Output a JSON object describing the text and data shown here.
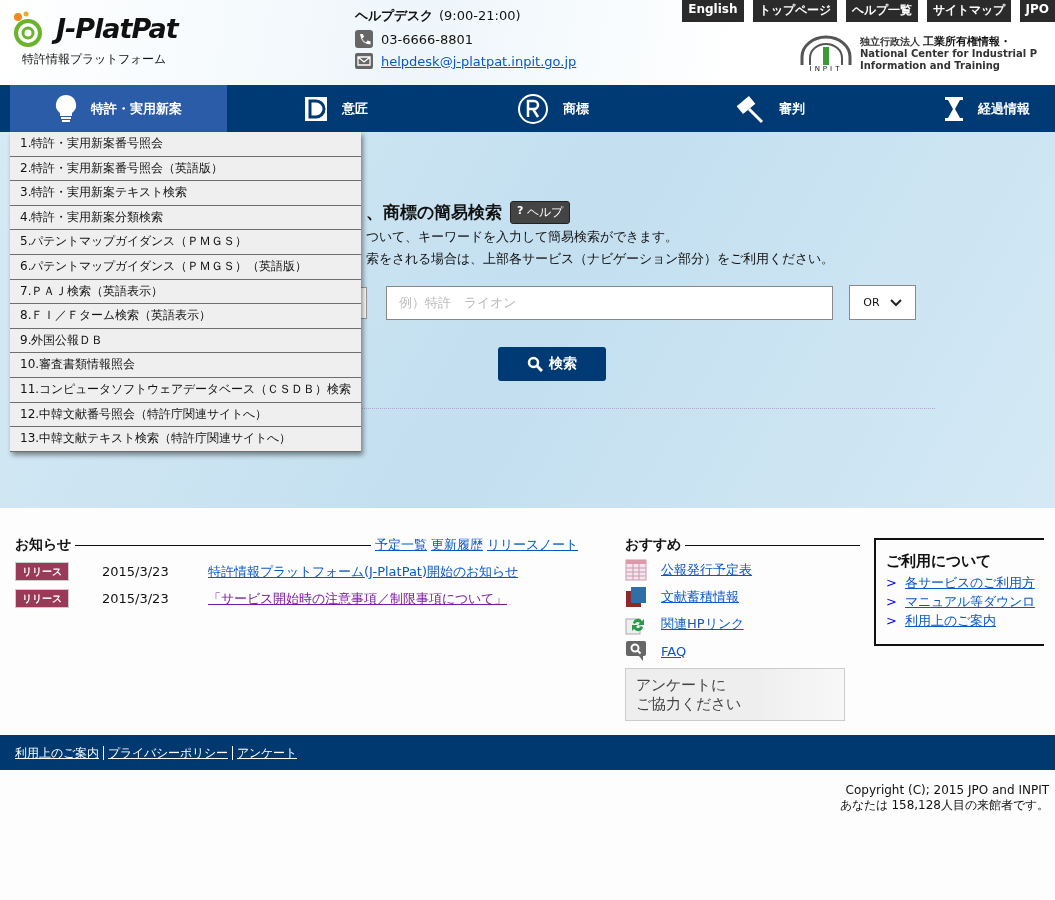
{
  "header": {
    "logo": {
      "name": "J-PlatPat",
      "subtitle": "特許情報プラットフォーム"
    },
    "helpdesk": {
      "title": "ヘルプデスク",
      "hours": "(9:00-21:00)",
      "phone": "03-6666-8801",
      "email": "helpdesk@j-platpat.inpit.go.jp"
    },
    "top_links": [
      "English",
      "トップページ",
      "ヘルプ一覧",
      "サイトマップ",
      "JPO"
    ],
    "org": {
      "mark": "INPIT",
      "prefix": "独立行政法人",
      "name": "工業所有権情報・",
      "english_1": "National Center for Industrial P",
      "english_2": "Information and Training"
    }
  },
  "nav": [
    {
      "kind": "bulb",
      "label": "特許・実用新案",
      "selected": true
    },
    {
      "kind": "design",
      "label": "意匠",
      "selected": false
    },
    {
      "kind": "trademark",
      "label": "商標",
      "selected": false
    },
    {
      "kind": "gavel",
      "label": "審判",
      "selected": false
    },
    {
      "kind": "hourglass",
      "label": "経過情報",
      "selected": false
    }
  ],
  "menu": [
    "1.特許・実用新案番号照会",
    "2.特許・実用新案番号照会（英語版）",
    "3.特許・実用新案テキスト検索",
    "4.特許・実用新案分類検索",
    "5.パテントマップガイダンス（ＰＭＧＳ）",
    "6.パテントマップガイダンス（ＰＭＧＳ）（英語版）",
    "7.ＰＡＪ検索（英語表示）",
    "8.ＦＩ／Ｆターム検索（英語表示）",
    "9.外国公報ＤＢ",
    "10.審査書類情報照会",
    "11.コンピュータソフトウェアデータベース（ＣＳＤＢ）検索",
    "12.中韓文献番号照会（特許庁関連サイトへ）",
    "13.中韓文献テキスト検索（特許庁関連サイトへ）"
  ],
  "search": {
    "title": "、商標の簡易検索",
    "help": "ヘルプ",
    "help_icon": "?",
    "lines": [
      "ついて、キーワードを入力して簡易検索ができます。",
      "索をされる場合は、上部各サービス（ナビゲーション部分）をご利用ください。"
    ],
    "placeholder": "例）特許　ライオン",
    "operator": "OR",
    "button": "検索"
  },
  "news": {
    "title": "お知らせ",
    "links": [
      "予定一覧",
      "更新履歴",
      "リリースノート"
    ],
    "items": [
      {
        "badge": "リリース",
        "date": "2015/3/23",
        "text": "特許情報プラットフォーム(J-PlatPat)開始のお知らせ",
        "visited": false
      },
      {
        "badge": "リリース",
        "date": "2015/3/23",
        "text": "「サービス開始時の注意事項／制限事項について」",
        "visited": true
      }
    ]
  },
  "recommend": {
    "title": "おすすめ",
    "items": [
      {
        "kind": "table",
        "label": "公報発行予定表"
      },
      {
        "kind": "books",
        "label": "文献蓄積情報"
      },
      {
        "kind": "links",
        "label": "関連HPリンク"
      },
      {
        "kind": "faq",
        "label": "FAQ"
      }
    ],
    "banner": [
      "アンケートに",
      "ご協力ください"
    ]
  },
  "usage": {
    "title": "ご利用について",
    "links": [
      "各サービスのご利用方",
      "マニュアル等ダウンロ",
      "利用上のご案内"
    ],
    "arrow": ">"
  },
  "footer": {
    "links": [
      "利用上のご案内",
      "プライバシーポリシー",
      "アンケート"
    ],
    "copyright": "Copyright (C); 2015 JPO and INPIT",
    "visitors": "あなたは 158,128人目の来館者です。"
  }
}
